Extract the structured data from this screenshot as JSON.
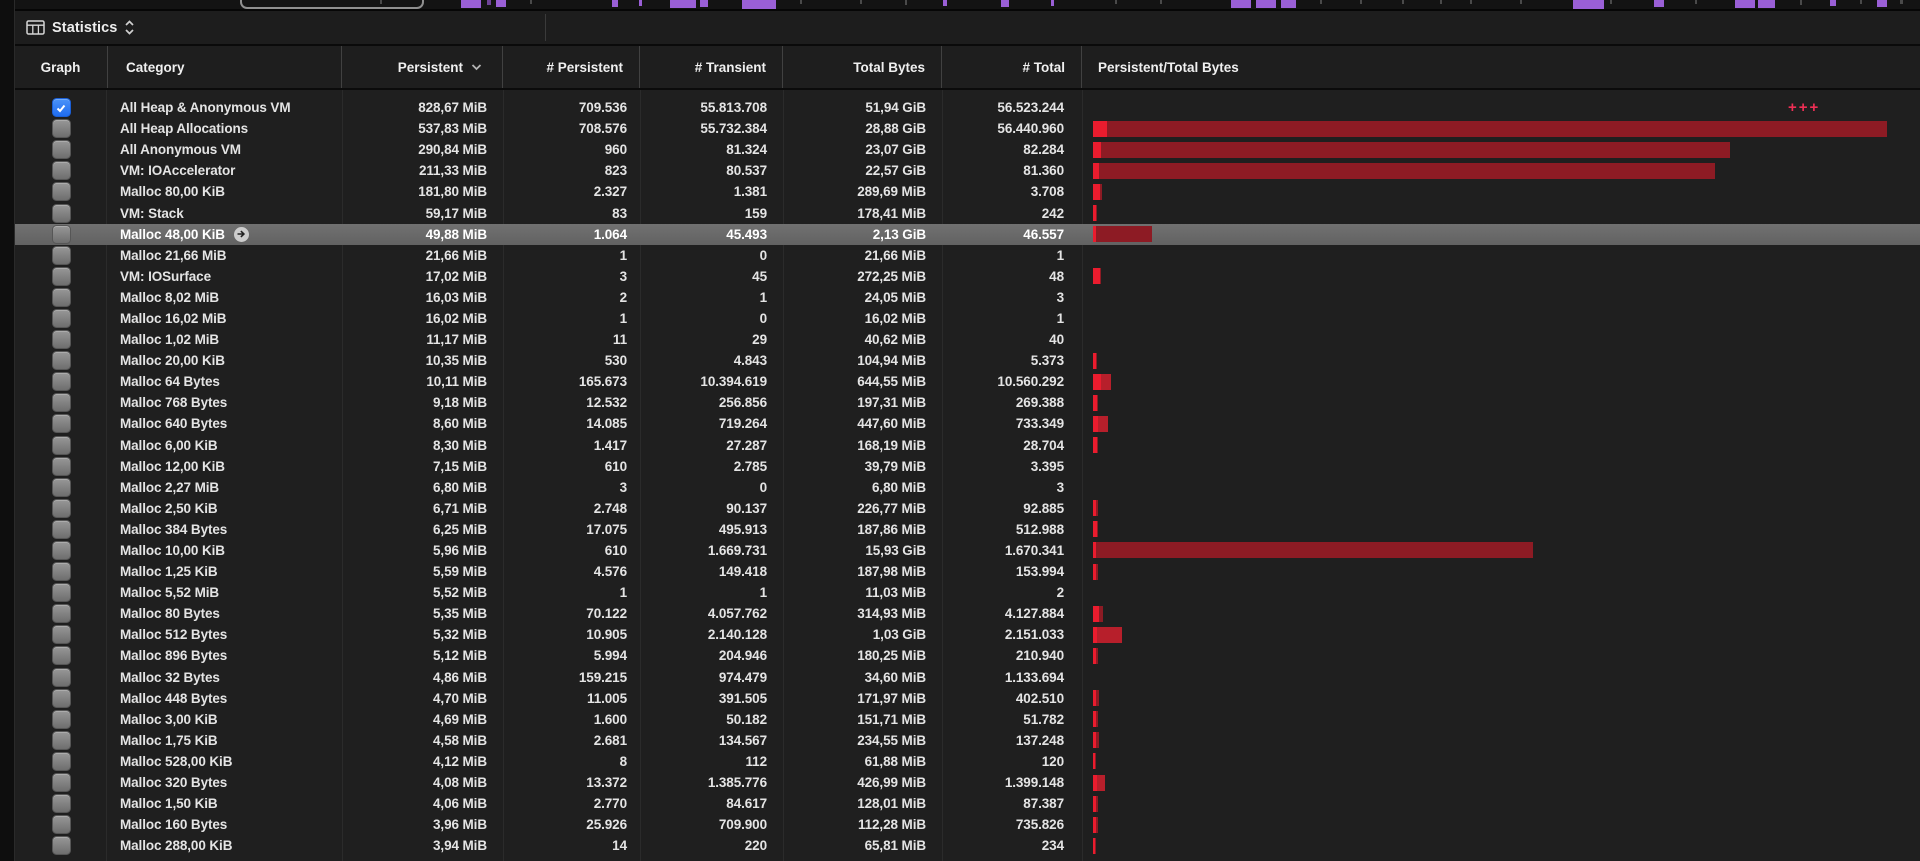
{
  "toolbar": {
    "title": "Statistics",
    "icon": "table-grid-icon"
  },
  "columns": [
    {
      "key": "graph",
      "label": "Graph"
    },
    {
      "key": "category",
      "label": "Category"
    },
    {
      "key": "persistent",
      "label": "Persistent",
      "sorted": "desc"
    },
    {
      "key": "num_persistent",
      "label": "# Persistent"
    },
    {
      "key": "num_transient",
      "label": "# Transient"
    },
    {
      "key": "total_bytes",
      "label": "Total Bytes"
    },
    {
      "key": "num_total",
      "label": "# Total"
    },
    {
      "key": "persistent_total",
      "label": "Persistent/Total Bytes"
    }
  ],
  "rows": [
    {
      "category": "All Heap & Anonymous VM",
      "persistent": "828,67 MiB",
      "num_persistent": "709.536",
      "num_transient": "55.813.708",
      "total_bytes": "51,94 GiB",
      "num_total": "56.523.244",
      "checked": true,
      "selected": false,
      "bar": null,
      "overflow_marker": "+++"
    },
    {
      "category": "All Heap Allocations",
      "persistent": "537,83 MiB",
      "num_persistent": "708.576",
      "num_transient": "55.732.384",
      "total_bytes": "28,88 GiB",
      "num_total": "56.440.960",
      "checked": false,
      "selected": false,
      "bar": {
        "p": 14,
        "t": 794,
        "tone": "dark"
      }
    },
    {
      "category": "All Anonymous VM",
      "persistent": "290,84 MiB",
      "num_persistent": "960",
      "num_transient": "81.324",
      "total_bytes": "23,07 GiB",
      "num_total": "82.284",
      "checked": false,
      "selected": false,
      "bar": {
        "p": 8,
        "t": 637,
        "tone": "dark"
      }
    },
    {
      "category": "VM: IOAccelerator",
      "persistent": "211,33 MiB",
      "num_persistent": "823",
      "num_transient": "80.537",
      "total_bytes": "22,57 GiB",
      "num_total": "81.360",
      "checked": false,
      "selected": false,
      "bar": {
        "p": 6,
        "t": 622,
        "tone": "dark"
      }
    },
    {
      "category": "Malloc 80,00 KiB",
      "persistent": "181,80 MiB",
      "num_persistent": "2.327",
      "num_transient": "1.381",
      "total_bytes": "289,69 MiB",
      "num_total": "3.708",
      "checked": false,
      "selected": false,
      "bar": {
        "p": 7,
        "t": 9,
        "tone": "dark"
      }
    },
    {
      "category": "VM: Stack",
      "persistent": "59,17 MiB",
      "num_persistent": "83",
      "num_transient": "159",
      "total_bytes": "178,41 MiB",
      "num_total": "242",
      "checked": false,
      "selected": false,
      "bar": {
        "p": 3,
        "t": 4,
        "tone": "dark"
      }
    },
    {
      "category": "Malloc 48,00 KiB",
      "persistent": "49,88 MiB",
      "num_persistent": "1.064",
      "num_transient": "45.493",
      "total_bytes": "2,13 GiB",
      "num_total": "46.557",
      "checked": false,
      "selected": true,
      "jump_arrow": true,
      "bar": {
        "p": 3,
        "t": 59,
        "tone": "dark"
      }
    },
    {
      "category": "Malloc 21,66 MiB",
      "persistent": "21,66 MiB",
      "num_persistent": "1",
      "num_transient": "0",
      "total_bytes": "21,66 MiB",
      "num_total": "1",
      "checked": false,
      "selected": false,
      "bar": null
    },
    {
      "category": "VM: IOSurface",
      "persistent": "17,02 MiB",
      "num_persistent": "3",
      "num_transient": "45",
      "total_bytes": "272,25 MiB",
      "num_total": "48",
      "checked": false,
      "selected": false,
      "bar": {
        "p": 7,
        "t": 8,
        "tone": "dark"
      }
    },
    {
      "category": "Malloc 8,02 MiB",
      "persistent": "16,03 MiB",
      "num_persistent": "2",
      "num_transient": "1",
      "total_bytes": "24,05 MiB",
      "num_total": "3",
      "checked": false,
      "selected": false,
      "bar": null
    },
    {
      "category": "Malloc 16,02 MiB",
      "persistent": "16,02 MiB",
      "num_persistent": "1",
      "num_transient": "0",
      "total_bytes": "16,02 MiB",
      "num_total": "1",
      "checked": false,
      "selected": false,
      "bar": null
    },
    {
      "category": "Malloc 1,02 MiB",
      "persistent": "11,17 MiB",
      "num_persistent": "11",
      "num_transient": "29",
      "total_bytes": "40,62 MiB",
      "num_total": "40",
      "checked": false,
      "selected": false,
      "bar": null
    },
    {
      "category": "Malloc 20,00 KiB",
      "persistent": "10,35 MiB",
      "num_persistent": "530",
      "num_transient": "4.843",
      "total_bytes": "104,94 MiB",
      "num_total": "5.373",
      "checked": false,
      "selected": false,
      "bar": {
        "p": 3,
        "t": 4,
        "tone": "dark"
      }
    },
    {
      "category": "Malloc 64 Bytes",
      "persistent": "10,11 MiB",
      "num_persistent": "165.673",
      "num_transient": "10.394.619",
      "total_bytes": "644,55 MiB",
      "num_total": "10.560.292",
      "checked": false,
      "selected": false,
      "bar": {
        "p": 8,
        "t": 18,
        "tone": "mid"
      }
    },
    {
      "category": "Malloc 768 Bytes",
      "persistent": "9,18 MiB",
      "num_persistent": "12.532",
      "num_transient": "256.856",
      "total_bytes": "197,31 MiB",
      "num_total": "269.388",
      "checked": false,
      "selected": false,
      "bar": {
        "p": 4,
        "t": 5,
        "tone": "dark"
      }
    },
    {
      "category": "Malloc 640 Bytes",
      "persistent": "8,60 MiB",
      "num_persistent": "14.085",
      "num_transient": "719.264",
      "total_bytes": "447,60 MiB",
      "num_total": "733.349",
      "checked": false,
      "selected": false,
      "bar": {
        "p": 5,
        "t": 15,
        "tone": "mid"
      }
    },
    {
      "category": "Malloc 6,00 KiB",
      "persistent": "8,30 MiB",
      "num_persistent": "1.417",
      "num_transient": "27.287",
      "total_bytes": "168,19 MiB",
      "num_total": "28.704",
      "checked": false,
      "selected": false,
      "bar": {
        "p": 4,
        "t": 5,
        "tone": "dark"
      }
    },
    {
      "category": "Malloc 12,00 KiB",
      "persistent": "7,15 MiB",
      "num_persistent": "610",
      "num_transient": "2.785",
      "total_bytes": "39,79 MiB",
      "num_total": "3.395",
      "checked": false,
      "selected": false,
      "bar": null
    },
    {
      "category": "Malloc 2,27 MiB",
      "persistent": "6,80 MiB",
      "num_persistent": "3",
      "num_transient": "0",
      "total_bytes": "6,80 MiB",
      "num_total": "3",
      "checked": false,
      "selected": false,
      "bar": null
    },
    {
      "category": "Malloc 2,50 KiB",
      "persistent": "6,71 MiB",
      "num_persistent": "2.748",
      "num_transient": "90.137",
      "total_bytes": "226,77 MiB",
      "num_total": "92.885",
      "checked": false,
      "selected": false,
      "bar": {
        "p": 3,
        "t": 5,
        "tone": "dark"
      }
    },
    {
      "category": "Malloc 384 Bytes",
      "persistent": "6,25 MiB",
      "num_persistent": "17.075",
      "num_transient": "495.913",
      "total_bytes": "187,86 MiB",
      "num_total": "512.988",
      "checked": false,
      "selected": false,
      "bar": {
        "p": 4,
        "t": 5,
        "tone": "dark"
      }
    },
    {
      "category": "Malloc 10,00 KiB",
      "persistent": "5,96 MiB",
      "num_persistent": "610",
      "num_transient": "1.669.731",
      "total_bytes": "15,93 GiB",
      "num_total": "1.670.341",
      "checked": false,
      "selected": false,
      "bar": {
        "p": 3,
        "t": 440,
        "tone": "dark"
      }
    },
    {
      "category": "Malloc 1,25 KiB",
      "persistent": "5,59 MiB",
      "num_persistent": "4.576",
      "num_transient": "149.418",
      "total_bytes": "187,98 MiB",
      "num_total": "153.994",
      "checked": false,
      "selected": false,
      "bar": {
        "p": 3,
        "t": 5,
        "tone": "dark"
      }
    },
    {
      "category": "Malloc 5,52 MiB",
      "persistent": "5,52 MiB",
      "num_persistent": "1",
      "num_transient": "1",
      "total_bytes": "11,03 MiB",
      "num_total": "2",
      "checked": false,
      "selected": false,
      "bar": null
    },
    {
      "category": "Malloc 80 Bytes",
      "persistent": "5,35 MiB",
      "num_persistent": "70.122",
      "num_transient": "4.057.762",
      "total_bytes": "314,93 MiB",
      "num_total": "4.127.884",
      "checked": false,
      "selected": false,
      "bar": {
        "p": 6,
        "t": 10,
        "tone": "dark"
      }
    },
    {
      "category": "Malloc 512 Bytes",
      "persistent": "5,32 MiB",
      "num_persistent": "10.905",
      "num_transient": "2.140.128",
      "total_bytes": "1,03 GiB",
      "num_total": "2.151.033",
      "checked": false,
      "selected": false,
      "bar": {
        "p": 4,
        "t": 29,
        "tone": "mid"
      }
    },
    {
      "category": "Malloc 896 Bytes",
      "persistent": "5,12 MiB",
      "num_persistent": "5.994",
      "num_transient": "204.946",
      "total_bytes": "180,25 MiB",
      "num_total": "210.940",
      "checked": false,
      "selected": false,
      "bar": {
        "p": 3,
        "t": 5,
        "tone": "dark"
      }
    },
    {
      "category": "Malloc 32 Bytes",
      "persistent": "4,86 MiB",
      "num_persistent": "159.215",
      "num_transient": "974.479",
      "total_bytes": "34,60 MiB",
      "num_total": "1.133.694",
      "checked": false,
      "selected": false,
      "bar": null
    },
    {
      "category": "Malloc 448 Bytes",
      "persistent": "4,70 MiB",
      "num_persistent": "11.005",
      "num_transient": "391.505",
      "total_bytes": "171,97 MiB",
      "num_total": "402.510",
      "checked": false,
      "selected": false,
      "bar": {
        "p": 3,
        "t": 6,
        "tone": "dark"
      }
    },
    {
      "category": "Malloc 3,00 KiB",
      "persistent": "4,69 MiB",
      "num_persistent": "1.600",
      "num_transient": "50.182",
      "total_bytes": "151,71 MiB",
      "num_total": "51.782",
      "checked": false,
      "selected": false,
      "bar": {
        "p": 3,
        "t": 5,
        "tone": "dark"
      }
    },
    {
      "category": "Malloc 1,75 KiB",
      "persistent": "4,58 MiB",
      "num_persistent": "2.681",
      "num_transient": "134.567",
      "total_bytes": "234,55 MiB",
      "num_total": "137.248",
      "checked": false,
      "selected": false,
      "bar": {
        "p": 3,
        "t": 6,
        "tone": "dark"
      }
    },
    {
      "category": "Malloc 528,00 KiB",
      "persistent": "4,12 MiB",
      "num_persistent": "8",
      "num_transient": "112",
      "total_bytes": "61,88 MiB",
      "num_total": "120",
      "checked": false,
      "selected": false,
      "bar": {
        "p": 2,
        "t": 3,
        "tone": "dark"
      }
    },
    {
      "category": "Malloc 320 Bytes",
      "persistent": "4,08 MiB",
      "num_persistent": "13.372",
      "num_transient": "1.385.776",
      "total_bytes": "426,99 MiB",
      "num_total": "1.399.148",
      "checked": false,
      "selected": false,
      "bar": {
        "p": 4,
        "t": 12,
        "tone": "mid"
      }
    },
    {
      "category": "Malloc 1,50 KiB",
      "persistent": "4,06 MiB",
      "num_persistent": "2.770",
      "num_transient": "84.617",
      "total_bytes": "128,01 MiB",
      "num_total": "87.387",
      "checked": false,
      "selected": false,
      "bar": {
        "p": 3,
        "t": 5,
        "tone": "dark"
      }
    },
    {
      "category": "Malloc 160 Bytes",
      "persistent": "3,96 MiB",
      "num_persistent": "25.926",
      "num_transient": "709.900",
      "total_bytes": "112,28 MiB",
      "num_total": "735.826",
      "checked": false,
      "selected": false,
      "bar": {
        "p": 3,
        "t": 5,
        "tone": "dark"
      }
    },
    {
      "category": "Malloc 288,00 KiB",
      "persistent": "3,94 MiB",
      "num_persistent": "14",
      "num_transient": "220",
      "total_bytes": "65,81 MiB",
      "num_total": "234",
      "checked": false,
      "selected": false,
      "bar": {
        "p": 2,
        "t": 3,
        "tone": "dark"
      }
    }
  ],
  "timeline": {
    "marks": [
      [
        380,
        2,
        4,
        "gray"
      ],
      [
        461,
        20,
        8,
        "purple"
      ],
      [
        487,
        4,
        5,
        "dim"
      ],
      [
        496,
        10,
        7,
        "purple"
      ],
      [
        530,
        2,
        4,
        "gray"
      ],
      [
        612,
        6,
        7,
        "purple"
      ],
      [
        639,
        3,
        6,
        "purple"
      ],
      [
        670,
        26,
        8,
        "purple"
      ],
      [
        700,
        8,
        7,
        "purple"
      ],
      [
        742,
        34,
        9,
        "purple"
      ],
      [
        800,
        2,
        4,
        "gray"
      ],
      [
        860,
        2,
        4,
        "gray"
      ],
      [
        905,
        2,
        5,
        "gray"
      ],
      [
        943,
        4,
        6,
        "purple"
      ],
      [
        1001,
        8,
        7,
        "purple"
      ],
      [
        1051,
        3,
        6,
        "purple"
      ],
      [
        1115,
        2,
        4,
        "gray"
      ],
      [
        1160,
        2,
        4,
        "gray"
      ],
      [
        1231,
        20,
        8,
        "purple"
      ],
      [
        1256,
        20,
        8,
        "purple"
      ],
      [
        1281,
        15,
        8,
        "purple"
      ],
      [
        1320,
        2,
        4,
        "gray"
      ],
      [
        1360,
        2,
        4,
        "gray"
      ],
      [
        1402,
        2,
        4,
        "gray"
      ],
      [
        1440,
        2,
        4,
        "gray"
      ],
      [
        1470,
        2,
        4,
        "gray"
      ],
      [
        1520,
        2,
        4,
        "gray"
      ],
      [
        1573,
        31,
        9,
        "purple"
      ],
      [
        1610,
        2,
        4,
        "gray"
      ],
      [
        1654,
        10,
        7,
        "purple"
      ],
      [
        1695,
        2,
        4,
        "gray"
      ],
      [
        1735,
        20,
        8,
        "purple"
      ],
      [
        1758,
        17,
        8,
        "purple"
      ],
      [
        1800,
        2,
        5,
        "gray"
      ],
      [
        1830,
        6,
        6,
        "purple"
      ],
      [
        1860,
        2,
        4,
        "gray"
      ],
      [
        1877,
        10,
        7,
        "purple"
      ],
      [
        1900,
        3,
        4,
        "gray"
      ]
    ]
  },
  "layout_columns_x": [
    106,
    342,
    503,
    640,
    783,
    942,
    1082
  ],
  "colors": {
    "accent_blue_hi": "#4b93f8",
    "accent_blue_lo": "#1f6cf0",
    "bar_bright": "#ea1c2e",
    "bar_dark": "#8d1b24",
    "bar_mid": "#b71f2b",
    "selected_row": "#6a6a6a",
    "timeline_purple": "#9a5fd6",
    "timeline_dim": "#6f4398",
    "timeline_gray": "#4a4a4a",
    "overflow_marks": "#ee2f55"
  }
}
